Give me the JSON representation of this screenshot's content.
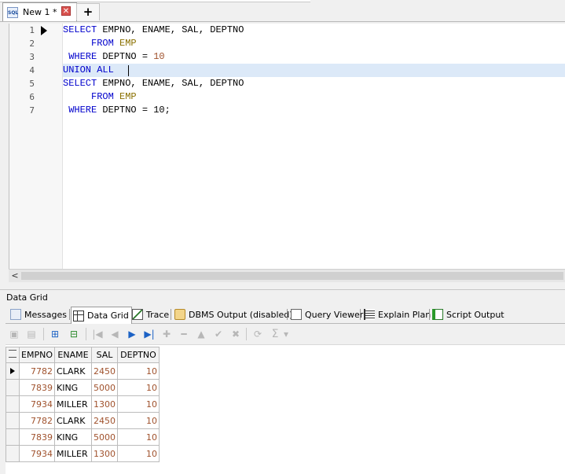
{
  "document_tab": {
    "icon_text": "SQL",
    "label": "New 1 *",
    "close_glyph": "✕",
    "add_glyph": "+"
  },
  "editor": {
    "line_numbers": [
      "1",
      "2",
      "3",
      "4",
      "5",
      "6",
      "7"
    ],
    "lines": [
      [
        {
          "t": "SELECT",
          "c": "kw"
        },
        {
          "t": " EMPNO, ENAME, SAL, DEPTNO",
          "c": ""
        }
      ],
      [
        {
          "t": "     FROM",
          "c": "kw"
        },
        {
          "t": " ",
          "c": ""
        },
        {
          "t": "EMP",
          "c": "tbl"
        }
      ],
      [
        {
          "t": " WHERE",
          "c": "kw"
        },
        {
          "t": " DEPTNO = ",
          "c": ""
        },
        {
          "t": "10",
          "c": "num"
        }
      ],
      [
        {
          "t": "UNION ALL",
          "c": "kw"
        }
      ],
      [
        {
          "t": "SELECT",
          "c": "kw"
        },
        {
          "t": " EMPNO, ENAME, SAL, DEPTNO",
          "c": ""
        }
      ],
      [
        {
          "t": "     FROM",
          "c": "kw"
        },
        {
          "t": " ",
          "c": ""
        },
        {
          "t": "EMP",
          "c": "tbl"
        }
      ],
      [
        {
          "t": " WHERE",
          "c": "kw"
        },
        {
          "t": " DEPTNO = 10;",
          "c": ""
        }
      ]
    ]
  },
  "hscroll": {
    "left_arrow": "<"
  },
  "panel": {
    "title": "Data Grid",
    "tabs": {
      "messages": "Messages",
      "data_grid": "Data Grid",
      "trace": "Trace",
      "dbms_output": "DBMS Output (disabled)",
      "query_viewer": "Query Viewer",
      "explain_plan": "Explain Plan",
      "script_output": "Script Output"
    }
  },
  "grid_toolbar": {
    "first": "|◀",
    "prev": "◀",
    "next": "▶",
    "last": "▶|",
    "insert": "✚",
    "delete": "━",
    "edit": "▲",
    "post": "✔",
    "cancel": "✖",
    "refresh": "⟳",
    "sum": "Σ",
    "dropdown": "▾"
  },
  "grid": {
    "columns": [
      "EMPNO",
      "ENAME",
      "SAL",
      "DEPTNO"
    ],
    "rows": [
      [
        "7782",
        "CLARK",
        "2450",
        "10"
      ],
      [
        "7839",
        "KING",
        "5000",
        "10"
      ],
      [
        "7934",
        "MILLER",
        "1300",
        "10"
      ],
      [
        "7782",
        "CLARK",
        "2450",
        "10"
      ],
      [
        "7839",
        "KING",
        "5000",
        "10"
      ],
      [
        "7934",
        "MILLER",
        "1300",
        "10"
      ]
    ],
    "current_row": 0
  },
  "colors": {
    "keyword": "#0000cc",
    "table": "#8a7000",
    "number": "#a0522d",
    "current_line": "#dce9f8"
  }
}
